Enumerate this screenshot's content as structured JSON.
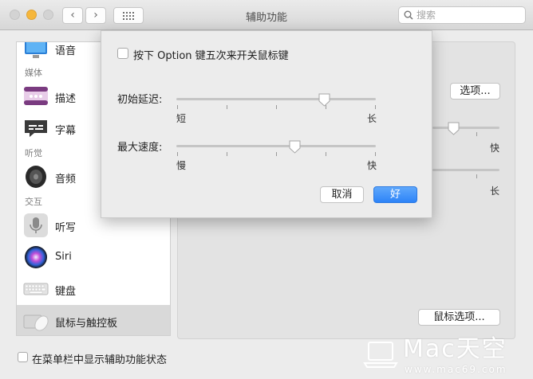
{
  "window": {
    "title": "辅助功能",
    "search_placeholder": "搜索"
  },
  "sidebar": {
    "items": [
      {
        "label": "语音",
        "icon": "monitor-voice-icon"
      },
      {
        "section": "媒体"
      },
      {
        "label": "描述",
        "icon": "descriptions-icon"
      },
      {
        "label": "字幕",
        "icon": "captions-icon"
      },
      {
        "section": "听觉"
      },
      {
        "label": "音频",
        "icon": "speaker-icon"
      },
      {
        "section": "交互"
      },
      {
        "label": "听写",
        "icon": "microphone-icon"
      },
      {
        "label": "Siri",
        "icon": "siri-icon"
      },
      {
        "label": "键盘",
        "icon": "keyboard-icon"
      },
      {
        "label": "鼠标与触控板",
        "icon": "mouse-trackpad-icon",
        "selected": true
      }
    ]
  },
  "panel": {
    "options_button": "选项...",
    "fast_label": "快",
    "long_label": "长",
    "mouse_options_button": "鼠标选项..."
  },
  "bottom": {
    "show_status_label": "在菜单栏中显示辅助功能状态",
    "show_status_checked": false
  },
  "dialog": {
    "toggle_label": "按下 Option 键五次来开关鼠标键",
    "toggle_checked": false,
    "initial_delay": {
      "label": "初始延迟:",
      "min_label": "短",
      "max_label": "长",
      "value_fraction": 0.74
    },
    "max_speed": {
      "label": "最大速度:",
      "min_label": "慢",
      "max_label": "快",
      "value_fraction": 0.595
    },
    "cancel_button": "取消",
    "ok_button": "好"
  },
  "watermark": {
    "brand": "Mac天空",
    "url": "www.mac69.com"
  }
}
